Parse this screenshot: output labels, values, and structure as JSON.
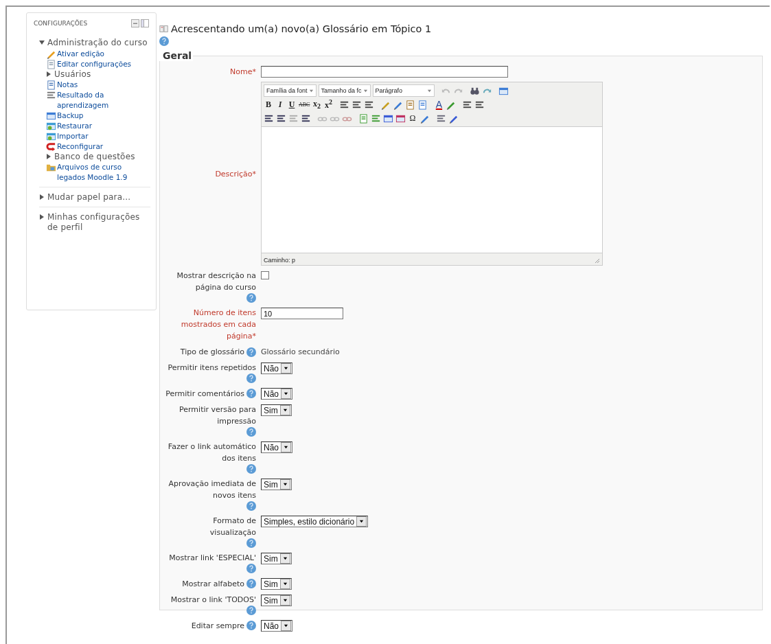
{
  "sidebar": {
    "title": "CONFIGURAÇÕES",
    "items": [
      {
        "label": "Administração do curso",
        "kind": "node",
        "expanded": true,
        "children": [
          {
            "label": "Ativar edição",
            "kind": "link"
          },
          {
            "label": "Editar configurações",
            "kind": "link"
          },
          {
            "label": "Usuários",
            "kind": "node",
            "expanded": false
          },
          {
            "label": "Notas",
            "kind": "link"
          },
          {
            "label": "Resultado da aprendizagem",
            "kind": "link"
          },
          {
            "label": "Backup",
            "kind": "link"
          },
          {
            "label": "Restaurar",
            "kind": "link"
          },
          {
            "label": "Importar",
            "kind": "link"
          },
          {
            "label": "Reconfigurar",
            "kind": "link"
          },
          {
            "label": "Banco de questões",
            "kind": "node",
            "expanded": false
          },
          {
            "label": "Arquivos de curso legados Moodle 1.9",
            "kind": "link"
          }
        ]
      },
      {
        "label": "Mudar papel para...",
        "kind": "node",
        "expanded": false
      },
      {
        "label": "Minhas configurações de perfil",
        "kind": "node",
        "expanded": false
      }
    ]
  },
  "page": {
    "title": "Acrescentando um(a) novo(a) Glossário em Tópico 1"
  },
  "form": {
    "legend": "Geral",
    "fields": [
      {
        "label": "Nome*",
        "kind": "text",
        "required": true,
        "help": false
      },
      {
        "label": "Descrição*",
        "kind": "editor",
        "required": true,
        "help": false,
        "path": "Caminho: p",
        "toolbar": [
          [
            {
              "kind": "select",
              "text": "Família da font"
            },
            {
              "kind": "select",
              "text": "Tamanho da fc"
            },
            {
              "kind": "select",
              "text": "Parágrafo"
            },
            {
              "kind": "sep"
            },
            {
              "kind": "icon"
            },
            {
              "kind": "icon"
            },
            {
              "kind": "sep"
            },
            {
              "kind": "icon"
            },
            {
              "kind": "icon"
            },
            {
              "kind": "sep"
            },
            {
              "kind": "icon"
            }
          ],
          [
            {
              "kind": "glyph",
              "text": "B"
            },
            {
              "kind": "glyph",
              "text": "I"
            },
            {
              "kind": "glyph",
              "text": "U"
            },
            {
              "kind": "glyph",
              "text": "ABC"
            },
            {
              "kind": "glyph",
              "text": "x$_{2}$"
            },
            {
              "kind": "glyph",
              "text": "x$^{2}$"
            },
            {
              "kind": "sep"
            },
            {
              "kind": "icon"
            },
            {
              "kind": "icon"
            },
            {
              "kind": "icon"
            },
            {
              "kind": "sep"
            },
            {
              "kind": "icon"
            },
            {
              "kind": "icon"
            },
            {
              "kind": "icon"
            },
            {
              "kind": "icon"
            },
            {
              "kind": "sep"
            },
            {
              "kind": "glyph",
              "text": "A"
            },
            {
              "kind": "icon"
            },
            {
              "kind": "sep"
            },
            {
              "kind": "icon"
            },
            {
              "kind": "icon"
            }
          ],
          [
            {
              "kind": "icon"
            },
            {
              "kind": "icon"
            },
            {
              "kind": "icon"
            },
            {
              "kind": "icon"
            },
            {
              "kind": "sep"
            },
            {
              "kind": "icon"
            },
            {
              "kind": "icon"
            },
            {
              "kind": "icon"
            },
            {
              "kind": "sep"
            },
            {
              "kind": "icon"
            },
            {
              "kind": "icon"
            },
            {
              "kind": "icon"
            },
            {
              "kind": "icon"
            },
            {
              "kind": "glyph",
              "text": "Ω"
            },
            {
              "kind": "icon"
            },
            {
              "kind": "sep"
            },
            {
              "kind": "icon"
            },
            {
              "kind": "icon"
            }
          ]
        ]
      },
      {
        "label": "Mostrar descrição na página do curso",
        "kind": "checkbox",
        "required": false,
        "help": true,
        "checked": false
      },
      {
        "label": "Número de itens mostrados em cada página*",
        "kind": "text",
        "required": true,
        "help": false,
        "value": "10"
      },
      {
        "label": "Tipo de glossário",
        "kind": "static",
        "required": false,
        "help": true,
        "value": "Glossário secundário"
      },
      {
        "label": "Permitir itens repetidos",
        "kind": "select",
        "required": false,
        "help": true,
        "value": "Não"
      },
      {
        "label": "Permitir comentários",
        "kind": "select",
        "required": false,
        "help": true,
        "value": "Não"
      },
      {
        "label": "Permitir versão para impressão",
        "kind": "select",
        "required": false,
        "help": true,
        "value": "Sim"
      },
      {
        "label": "Fazer o link automático dos itens",
        "kind": "select",
        "required": false,
        "help": true,
        "value": "Não"
      },
      {
        "label": "Aprovação imediata de novos itens",
        "kind": "select",
        "required": false,
        "help": true,
        "value": "Sim"
      },
      {
        "label": "Formato de visualização",
        "kind": "select",
        "required": false,
        "help": true,
        "value": "Simples, estilo dicionário"
      },
      {
        "label": "Mostrar link 'ESPECIAL'",
        "kind": "select",
        "required": false,
        "help": true,
        "value": "Sim"
      },
      {
        "label": "Mostrar alfabeto",
        "kind": "select",
        "required": false,
        "help": true,
        "value": "Sim"
      },
      {
        "label": "Mostrar o link 'TODOS'",
        "kind": "select",
        "required": false,
        "help": true,
        "value": "Sim"
      },
      {
        "label": "Editar sempre",
        "kind": "select",
        "required": false,
        "help": true,
        "value": "Não"
      }
    ]
  }
}
